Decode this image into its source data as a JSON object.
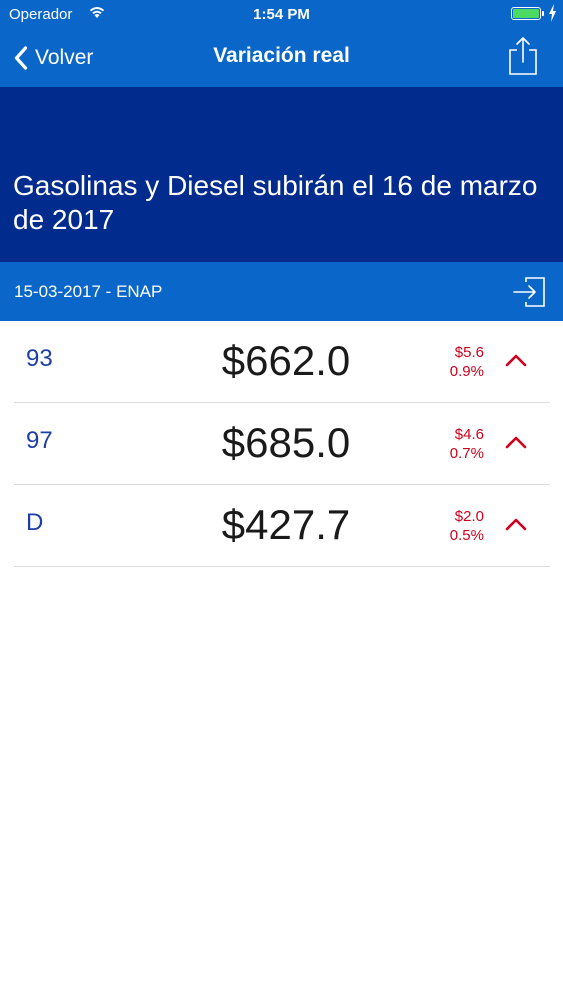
{
  "status_bar": {
    "carrier": "Operador",
    "time": "1:54 PM",
    "icons": [
      "wifi-icon",
      "battery-icon",
      "charging-bolt-icon"
    ]
  },
  "nav": {
    "back_label": "Volver",
    "title": "Variación real",
    "back_icon": "chevron-left-icon",
    "share_icon": "share-icon"
  },
  "headline": {
    "text": "Gasolinas y Diesel subirán el 16 de marzo de 2017"
  },
  "info_bar": {
    "text": "15-03-2017 - ENAP",
    "action_icon": "login-icon"
  },
  "prices": [
    {
      "type": "93",
      "price": "$662.0",
      "change_amount": "$5.6",
      "change_percent": "0.9%",
      "trend": "up"
    },
    {
      "type": "97",
      "price": "$685.0",
      "change_amount": "$4.6",
      "change_percent": "0.7%",
      "trend": "up"
    },
    {
      "type": "D",
      "price": "$427.7",
      "change_amount": "$2.0",
      "change_percent": "0.5%",
      "trend": "up"
    }
  ],
  "colors": {
    "nav_blue": "#0a67c9",
    "headline_blue": "#022b8e",
    "fuel_label": "#1f3fa8",
    "increase_red": "#d0011b",
    "battery_green": "#4cd964"
  }
}
